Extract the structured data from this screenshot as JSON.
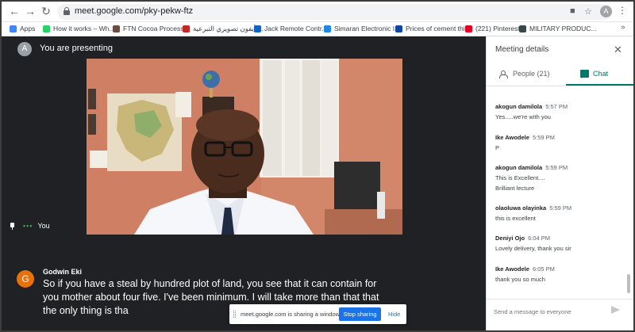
{
  "browser": {
    "url": "meet.google.com/pky-pekw-ftz",
    "profile_initial": "A",
    "bookmarks": [
      {
        "label": "Apps",
        "color": "#4285f4"
      },
      {
        "label": "How it works – Wh...",
        "color": "#25d366"
      },
      {
        "label": "FTN Cocoa Process...",
        "color": "#6d4c41"
      },
      {
        "label": "أيفون تصويري التبرعية ...",
        "color": "#c62828"
      },
      {
        "label": "Jack Remote Contr...",
        "color": "#1565c0"
      },
      {
        "label": "Simaran Electronic I...",
        "color": "#1e88e5"
      },
      {
        "label": "Prices of cement thi...",
        "color": "#0d47a1"
      },
      {
        "label": "(221) Pinterest",
        "color": "#e60023"
      },
      {
        "label": "MILITARY PRODUC...",
        "color": "#37474f"
      }
    ]
  },
  "meet": {
    "presenter_initial": "A",
    "presenting_label": "You are presenting",
    "self_label": "You",
    "caption": {
      "speaker_initial": "G",
      "speaker": "Godwin Eki",
      "text": "So if you have a steal by hundred plot of land, you see that it can contain for you mother about four five. I've been minimum. I will take more than that that the only thing is tha"
    },
    "share_bar": {
      "message": "meet.google.com is sharing a window.",
      "stop_label": "Stop sharing",
      "hide_label": "Hide"
    }
  },
  "panel": {
    "title": "Meeting details",
    "tab_people": "People (21)",
    "tab_chat": "Chat",
    "send_placeholder": "Send a message to everyone",
    "messages": [
      {
        "sender": "akogun damilola",
        "time": "5:57 PM",
        "lines": [
          "Yes.....we're with you"
        ]
      },
      {
        "sender": "Ike Awodele",
        "time": "5:59 PM",
        "lines": [
          "P"
        ]
      },
      {
        "sender": "akogun damilola",
        "time": "5:59 PM",
        "lines": [
          "This is Excellent....",
          "Brilliant lecture"
        ]
      },
      {
        "sender": "olaoluwa olayinka",
        "time": "5:59 PM",
        "lines": [
          "this is excellent"
        ]
      },
      {
        "sender": "Deniyi Ojo",
        "time": "6:04 PM",
        "lines": [
          "Lovely delivery, thank you sir"
        ]
      },
      {
        "sender": "Ike Awodele",
        "time": "6:05 PM",
        "lines": [
          "thank you so much"
        ]
      }
    ]
  }
}
